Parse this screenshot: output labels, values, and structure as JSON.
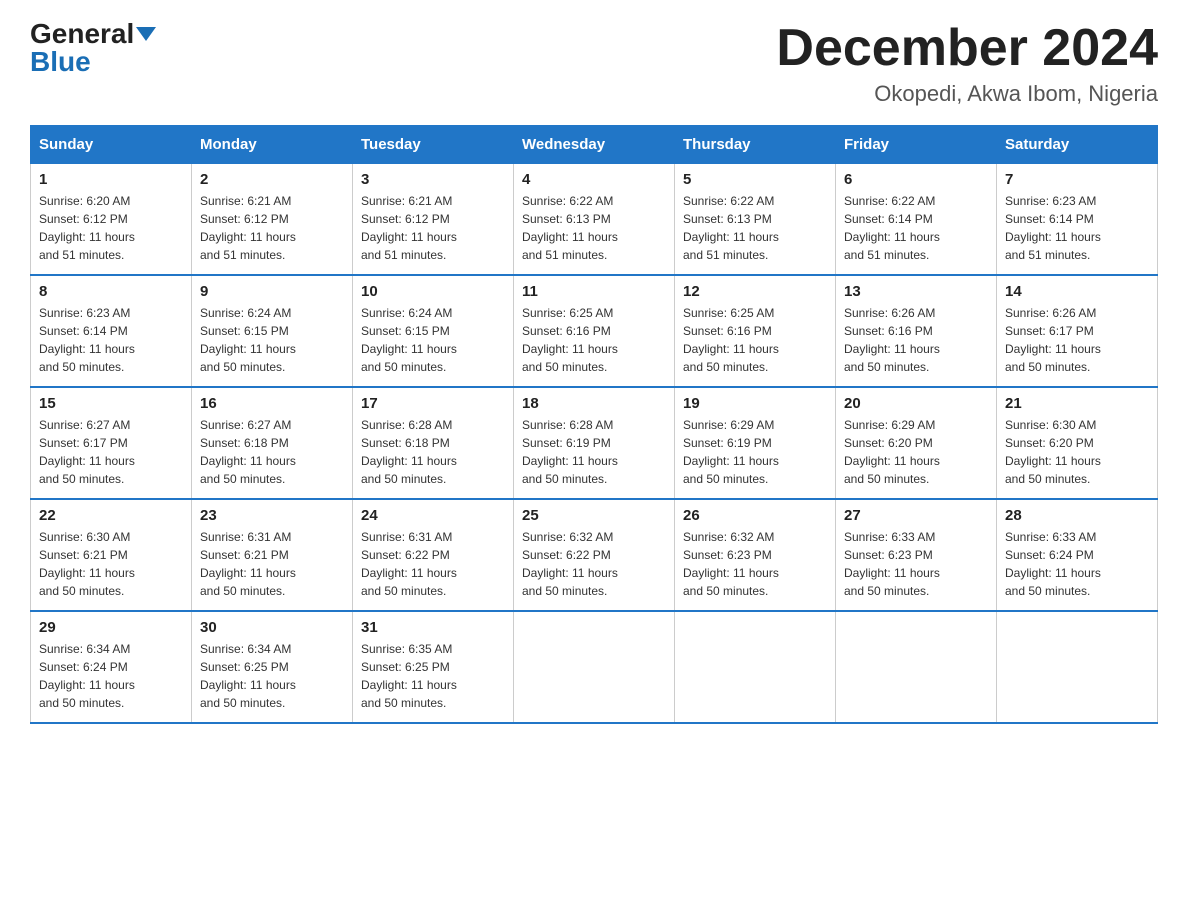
{
  "header": {
    "logo_general": "General",
    "logo_blue": "Blue",
    "month_title": "December 2024",
    "location": "Okopedi, Akwa Ibom, Nigeria"
  },
  "days_of_week": [
    "Sunday",
    "Monday",
    "Tuesday",
    "Wednesday",
    "Thursday",
    "Friday",
    "Saturday"
  ],
  "weeks": [
    [
      {
        "day": "1",
        "sunrise": "6:20 AM",
        "sunset": "6:12 PM",
        "daylight": "11 hours and 51 minutes."
      },
      {
        "day": "2",
        "sunrise": "6:21 AM",
        "sunset": "6:12 PM",
        "daylight": "11 hours and 51 minutes."
      },
      {
        "day": "3",
        "sunrise": "6:21 AM",
        "sunset": "6:12 PM",
        "daylight": "11 hours and 51 minutes."
      },
      {
        "day": "4",
        "sunrise": "6:22 AM",
        "sunset": "6:13 PM",
        "daylight": "11 hours and 51 minutes."
      },
      {
        "day": "5",
        "sunrise": "6:22 AM",
        "sunset": "6:13 PM",
        "daylight": "11 hours and 51 minutes."
      },
      {
        "day": "6",
        "sunrise": "6:22 AM",
        "sunset": "6:14 PM",
        "daylight": "11 hours and 51 minutes."
      },
      {
        "day": "7",
        "sunrise": "6:23 AM",
        "sunset": "6:14 PM",
        "daylight": "11 hours and 51 minutes."
      }
    ],
    [
      {
        "day": "8",
        "sunrise": "6:23 AM",
        "sunset": "6:14 PM",
        "daylight": "11 hours and 50 minutes."
      },
      {
        "day": "9",
        "sunrise": "6:24 AM",
        "sunset": "6:15 PM",
        "daylight": "11 hours and 50 minutes."
      },
      {
        "day": "10",
        "sunrise": "6:24 AM",
        "sunset": "6:15 PM",
        "daylight": "11 hours and 50 minutes."
      },
      {
        "day": "11",
        "sunrise": "6:25 AM",
        "sunset": "6:16 PM",
        "daylight": "11 hours and 50 minutes."
      },
      {
        "day": "12",
        "sunrise": "6:25 AM",
        "sunset": "6:16 PM",
        "daylight": "11 hours and 50 minutes."
      },
      {
        "day": "13",
        "sunrise": "6:26 AM",
        "sunset": "6:16 PM",
        "daylight": "11 hours and 50 minutes."
      },
      {
        "day": "14",
        "sunrise": "6:26 AM",
        "sunset": "6:17 PM",
        "daylight": "11 hours and 50 minutes."
      }
    ],
    [
      {
        "day": "15",
        "sunrise": "6:27 AM",
        "sunset": "6:17 PM",
        "daylight": "11 hours and 50 minutes."
      },
      {
        "day": "16",
        "sunrise": "6:27 AM",
        "sunset": "6:18 PM",
        "daylight": "11 hours and 50 minutes."
      },
      {
        "day": "17",
        "sunrise": "6:28 AM",
        "sunset": "6:18 PM",
        "daylight": "11 hours and 50 minutes."
      },
      {
        "day": "18",
        "sunrise": "6:28 AM",
        "sunset": "6:19 PM",
        "daylight": "11 hours and 50 minutes."
      },
      {
        "day": "19",
        "sunrise": "6:29 AM",
        "sunset": "6:19 PM",
        "daylight": "11 hours and 50 minutes."
      },
      {
        "day": "20",
        "sunrise": "6:29 AM",
        "sunset": "6:20 PM",
        "daylight": "11 hours and 50 minutes."
      },
      {
        "day": "21",
        "sunrise": "6:30 AM",
        "sunset": "6:20 PM",
        "daylight": "11 hours and 50 minutes."
      }
    ],
    [
      {
        "day": "22",
        "sunrise": "6:30 AM",
        "sunset": "6:21 PM",
        "daylight": "11 hours and 50 minutes."
      },
      {
        "day": "23",
        "sunrise": "6:31 AM",
        "sunset": "6:21 PM",
        "daylight": "11 hours and 50 minutes."
      },
      {
        "day": "24",
        "sunrise": "6:31 AM",
        "sunset": "6:22 PM",
        "daylight": "11 hours and 50 minutes."
      },
      {
        "day": "25",
        "sunrise": "6:32 AM",
        "sunset": "6:22 PM",
        "daylight": "11 hours and 50 minutes."
      },
      {
        "day": "26",
        "sunrise": "6:32 AM",
        "sunset": "6:23 PM",
        "daylight": "11 hours and 50 minutes."
      },
      {
        "day": "27",
        "sunrise": "6:33 AM",
        "sunset": "6:23 PM",
        "daylight": "11 hours and 50 minutes."
      },
      {
        "day": "28",
        "sunrise": "6:33 AM",
        "sunset": "6:24 PM",
        "daylight": "11 hours and 50 minutes."
      }
    ],
    [
      {
        "day": "29",
        "sunrise": "6:34 AM",
        "sunset": "6:24 PM",
        "daylight": "11 hours and 50 minutes."
      },
      {
        "day": "30",
        "sunrise": "6:34 AM",
        "sunset": "6:25 PM",
        "daylight": "11 hours and 50 minutes."
      },
      {
        "day": "31",
        "sunrise": "6:35 AM",
        "sunset": "6:25 PM",
        "daylight": "11 hours and 50 minutes."
      },
      null,
      null,
      null,
      null
    ]
  ],
  "labels": {
    "sunrise": "Sunrise:",
    "sunset": "Sunset:",
    "daylight": "Daylight:"
  }
}
